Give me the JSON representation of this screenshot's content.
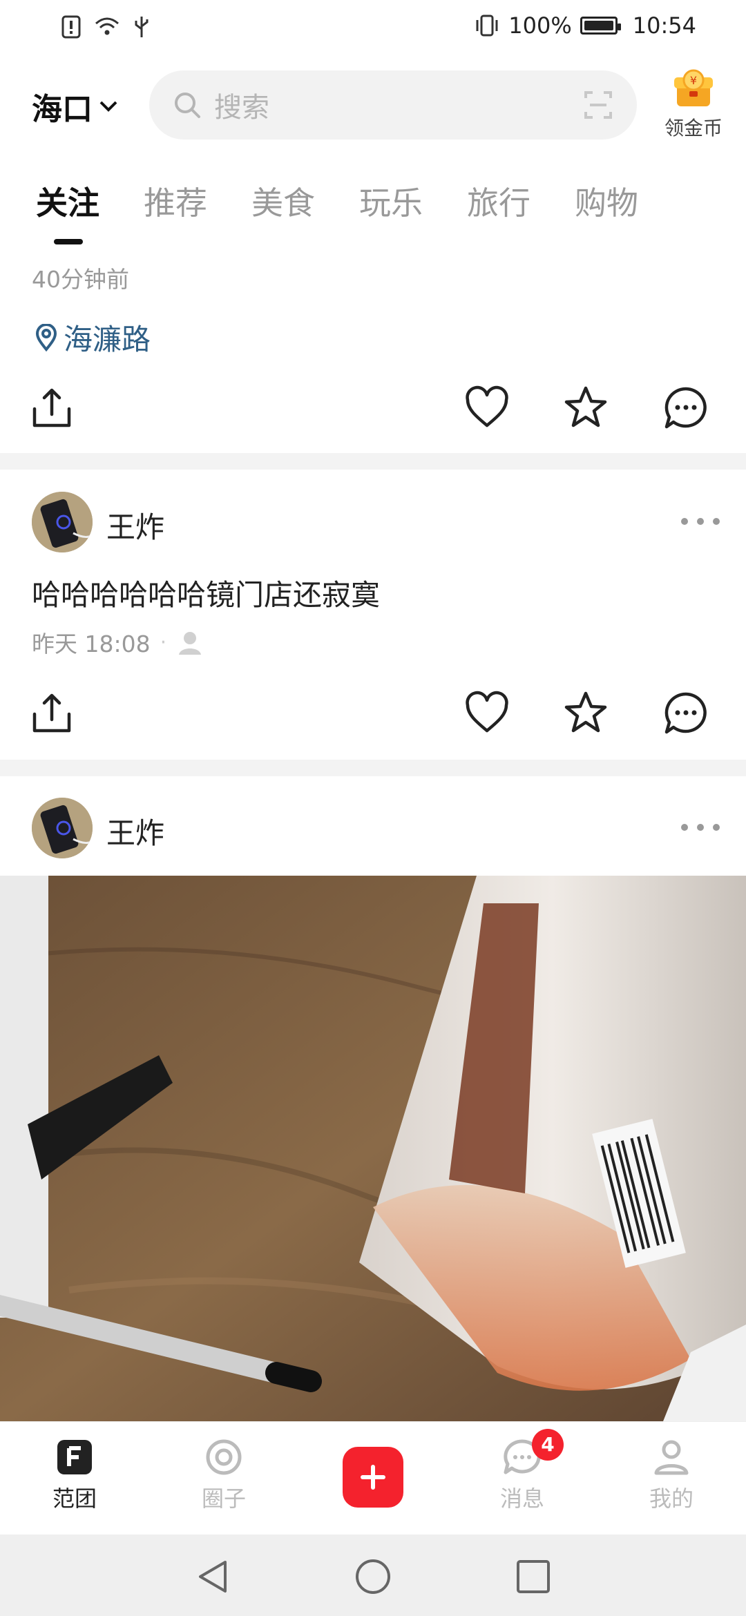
{
  "status_bar": {
    "battery": "100%",
    "time": "10:54"
  },
  "header": {
    "city": "海口",
    "search_placeholder": "搜索",
    "coin_label": "领金币"
  },
  "tabs": [
    {
      "label": "关注",
      "active": true
    },
    {
      "label": "推荐",
      "active": false
    },
    {
      "label": "美食",
      "active": false
    },
    {
      "label": "玩乐",
      "active": false
    },
    {
      "label": "旅行",
      "active": false
    },
    {
      "label": "购物",
      "active": false
    }
  ],
  "feed": {
    "post0": {
      "time": "40分钟前",
      "location": "海濂路"
    },
    "post1": {
      "user": "王炸",
      "text": "哈哈哈哈哈哈镜门店还寂寞",
      "time": "昨天 18:08"
    },
    "post2": {
      "user": "王炸"
    }
  },
  "bottom_nav": {
    "items": [
      {
        "label": "范团",
        "icon": "fantuan-logo-icon",
        "active": true
      },
      {
        "label": "圈子",
        "icon": "circle-target-icon",
        "active": false
      },
      {
        "label": "",
        "icon": "add-icon",
        "active": false
      },
      {
        "label": "消息",
        "icon": "message-icon",
        "active": false,
        "badge": "4"
      },
      {
        "label": "我的",
        "icon": "profile-icon",
        "active": false
      }
    ]
  },
  "colors": {
    "accent": "#f4222d",
    "location": "#2f5f86",
    "muted": "#999999"
  }
}
